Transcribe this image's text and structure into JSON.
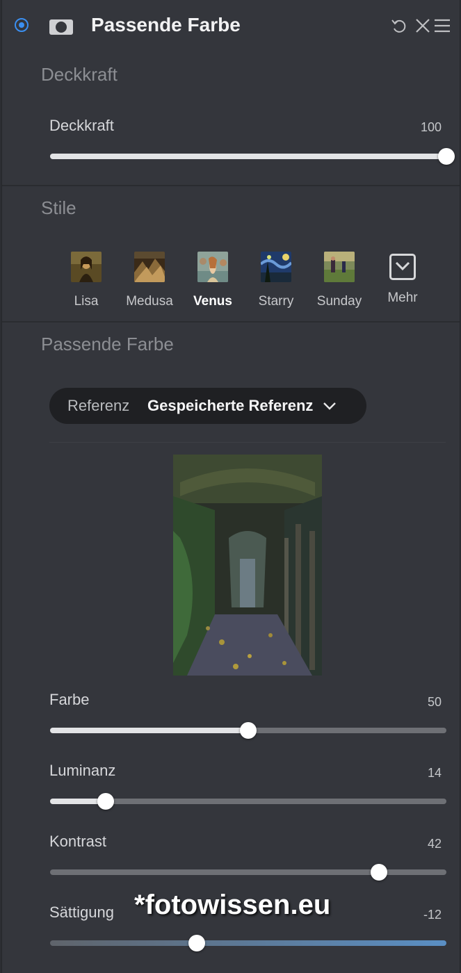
{
  "header": {
    "title": "Passende Farbe",
    "icons": [
      "power-toggle-icon",
      "mask-icon",
      "reset-icon",
      "close-icon",
      "menu-icon"
    ],
    "accent": "#3b8ff0"
  },
  "opacity_section": {
    "title": "Deckkraft",
    "slider": {
      "label": "Deckkraft",
      "value": "100",
      "fraction": 1.0
    }
  },
  "styles_section": {
    "title": "Stile",
    "items": [
      {
        "label": "Lisa",
        "active": false
      },
      {
        "label": "Medusa",
        "active": false
      },
      {
        "label": "Venus",
        "active": true
      },
      {
        "label": "Starry",
        "active": false
      },
      {
        "label": "Sunday",
        "active": false
      },
      {
        "label": "Mehr",
        "active": false
      }
    ]
  },
  "match_section": {
    "title": "Passende Farbe",
    "reference": {
      "label": "Referenz",
      "value": "Gespeicherte Referenz"
    },
    "sliders": [
      {
        "label": "Farbe",
        "value": "50",
        "fraction": 0.5
      },
      {
        "label": "Luminanz",
        "value": "14",
        "fraction": 0.14
      },
      {
        "label": "Kontrast",
        "value": "42",
        "fraction": 0.83
      },
      {
        "label": "Sättigung",
        "value": "-12",
        "fraction": 0.37
      }
    ]
  },
  "watermark": "*fotowissen.eu"
}
